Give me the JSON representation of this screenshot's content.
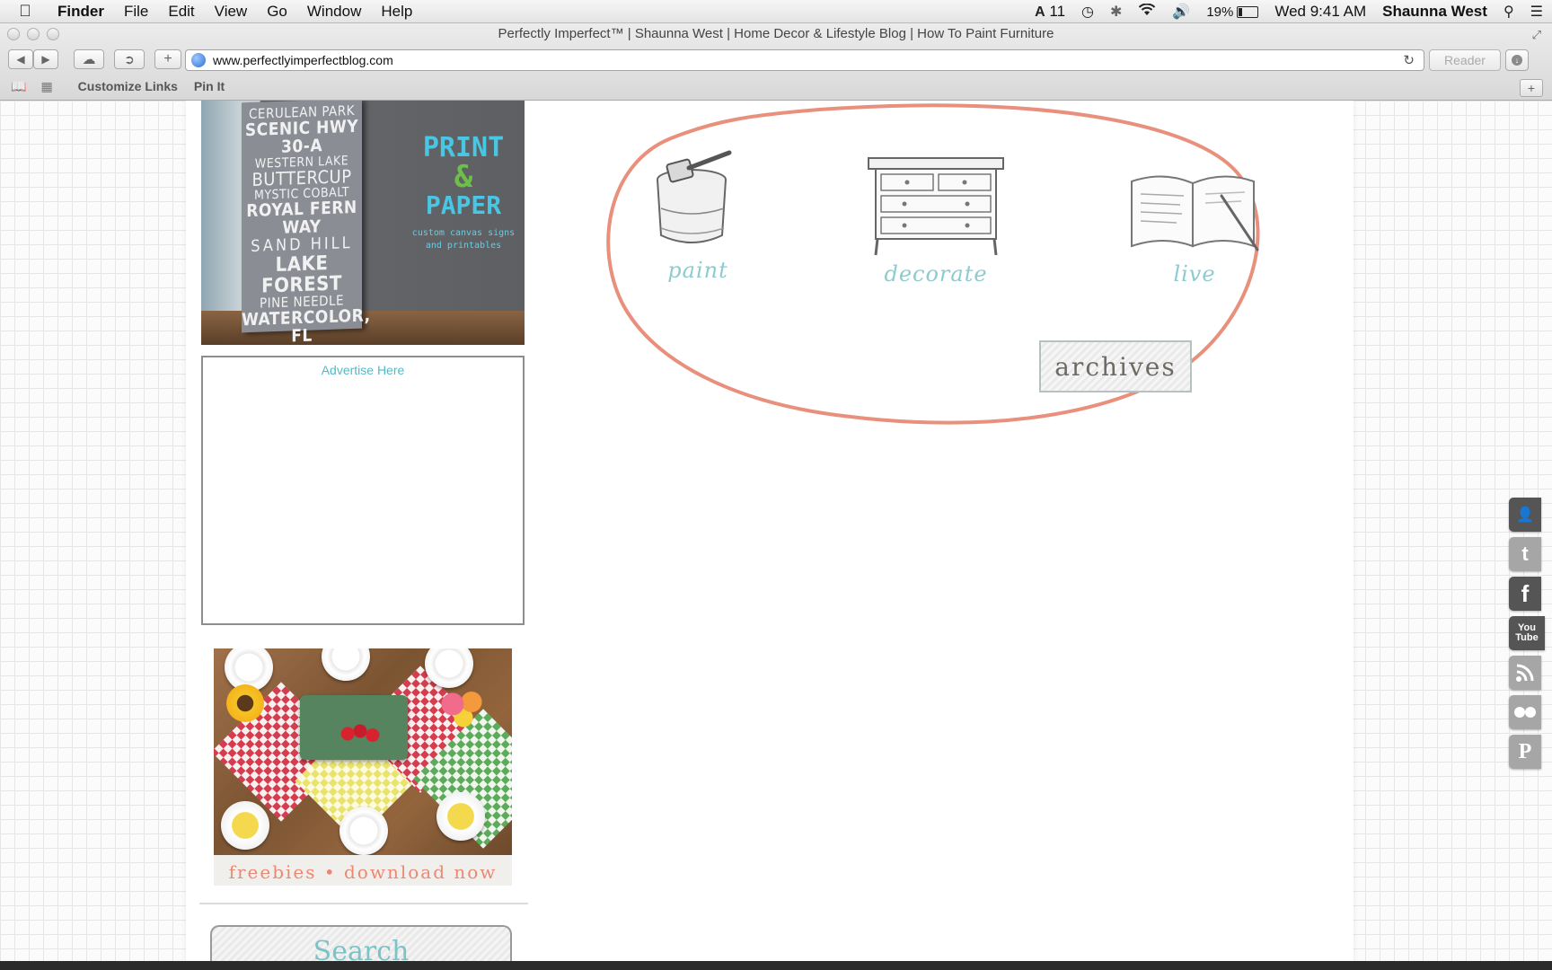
{
  "menubar": {
    "app_name": "Finder",
    "items": [
      "File",
      "Edit",
      "View",
      "Go",
      "Window",
      "Help"
    ],
    "status": {
      "adobe_count": "11",
      "battery_percent": "19%",
      "battery_level": 0.19,
      "clock": "Wed 9:41 AM",
      "user": "Shaunna West"
    }
  },
  "browser": {
    "window_title": "Perfectly Imperfect™ | Shaunna West | Home Decor & Lifestyle Blog | How To Paint Furniture",
    "url": "www.perfectlyimperfectblog.com",
    "reader_label": "Reader",
    "bookmarks": [
      "Customize Links",
      "Pin It"
    ]
  },
  "sidebar": {
    "print_ad": {
      "sign_lines": [
        "CERULEAN PARK",
        "SCENIC HWY 30-A",
        "WESTERN LAKE",
        "BUTTERCUP",
        "MYSTIC COBALT",
        "ROYAL FERN WAY",
        "SAND HILL",
        "LAKE FOREST",
        "PINE NEEDLE",
        "WATERCOLOR, FL"
      ],
      "promo_line1": "PRINT",
      "promo_amp": "&",
      "promo_line2": "PAPER",
      "promo_sub": "custom canvas signs and printables"
    },
    "advertise_label": "Advertise Here",
    "freebies_caption": "freebies • download now",
    "search_label": "Search"
  },
  "categories": {
    "items": [
      "paint",
      "decorate",
      "live"
    ],
    "archives_label": "archives",
    "accent_color": "#8ccbd0",
    "oval_color": "#e9907c"
  },
  "social_icons": [
    "contact-icon",
    "twitter-icon",
    "facebook-icon",
    "youtube-icon",
    "rss-icon",
    "flickr-icon",
    "pinterest-icon"
  ],
  "social_text": {
    "facebook": "f",
    "youtube": "You Tube",
    "pinterest": "P"
  }
}
